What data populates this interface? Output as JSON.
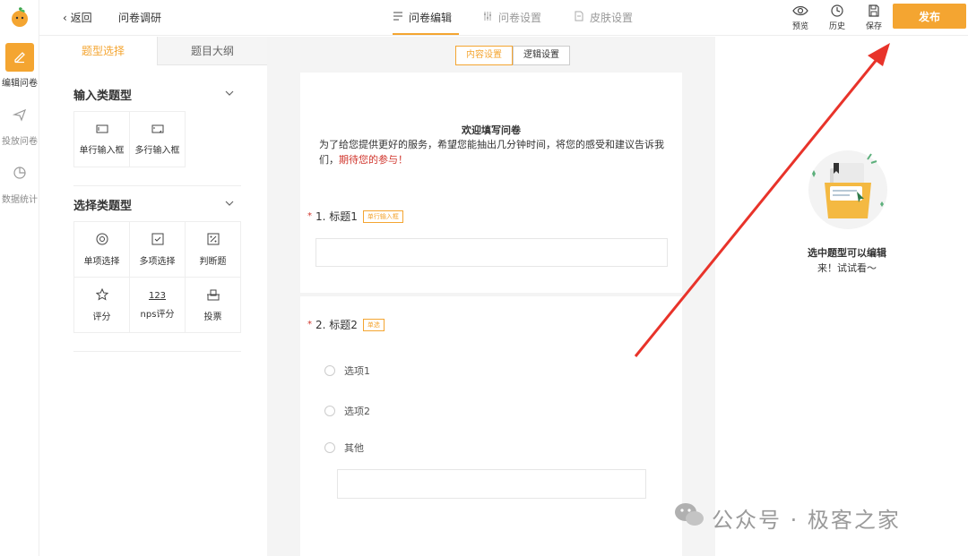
{
  "rail": {
    "items": [
      {
        "label": "编辑问卷",
        "icon": "pencil-icon",
        "active": true
      },
      {
        "label": "投放问卷",
        "icon": "paper-plane-icon",
        "active": false
      },
      {
        "label": "数据统计",
        "icon": "pie-chart-icon",
        "active": false
      }
    ]
  },
  "topbar": {
    "back_label": "返回",
    "survey_title": "问卷调研",
    "tabs": [
      {
        "label": "问卷编辑",
        "icon": "list-icon"
      },
      {
        "label": "问卷设置",
        "icon": "sliders-icon"
      },
      {
        "label": "皮肤设置",
        "icon": "document-icon"
      }
    ],
    "tools": [
      {
        "label": "预览",
        "icon": "eye-icon"
      },
      {
        "label": "历史",
        "icon": "clock-icon"
      },
      {
        "label": "保存",
        "icon": "save-icon"
      }
    ],
    "publish_label": "发布"
  },
  "panel": {
    "tabs": [
      "题型选择",
      "题目大纲"
    ],
    "input_group": {
      "title": "输入类题型",
      "items": [
        {
          "label": "单行输入框",
          "icon": "single-line-input-icon"
        },
        {
          "label": "多行输入框",
          "icon": "multi-line-input-icon"
        }
      ]
    },
    "choice_group": {
      "title": "选择类题型",
      "items": [
        {
          "label": "单项选择",
          "icon": "radio-icon"
        },
        {
          "label": "多项选择",
          "icon": "checkbox-icon"
        },
        {
          "label": "判断题",
          "icon": "judge-icon"
        },
        {
          "label": "评分",
          "icon": "star-icon"
        },
        {
          "label": "nps评分",
          "icon": "nps-icon",
          "glyph": "123"
        },
        {
          "label": "投票",
          "icon": "vote-icon"
        }
      ]
    }
  },
  "canvas": {
    "subtabs": [
      "内容设置",
      "逻辑设置"
    ],
    "welcome": {
      "title": "欢迎填写问卷",
      "desc": "为了给您提供更好的服务，希望您能抽出几分钟时间，将您的感受和建议告诉我们，",
      "highlight": "期待您的参与！"
    },
    "questions": [
      {
        "number": "1. 标题1",
        "tag": "单行输入框"
      },
      {
        "number": "2. 标题2",
        "tag": "单选",
        "options": [
          "选项1",
          "选项2",
          "其他"
        ]
      }
    ]
  },
  "right": {
    "hint_title": "选中题型可以编辑",
    "hint_sub": "来！试试看～"
  },
  "watermark": "公众号 · 极客之家",
  "colors": {
    "accent": "#f4a531",
    "required": "#d0352c",
    "arrow": "#e8332a"
  }
}
